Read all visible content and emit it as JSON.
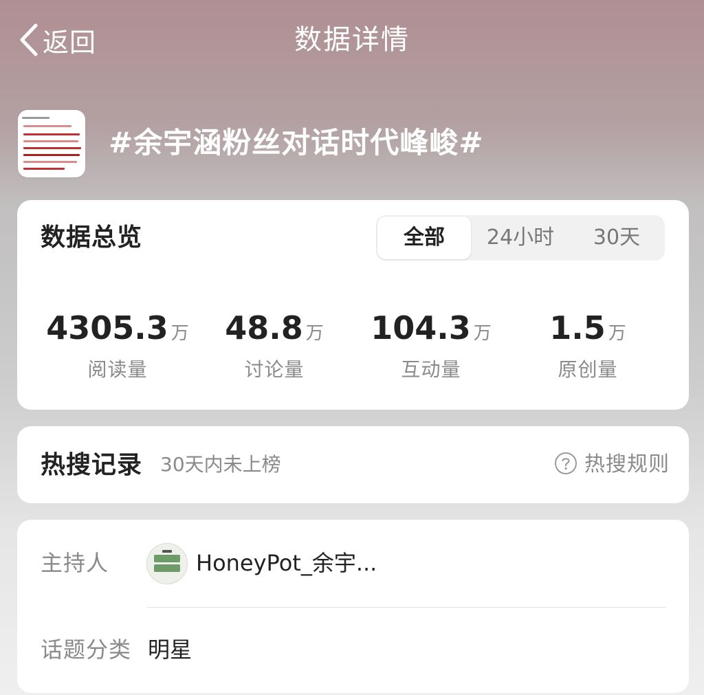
{
  "header": {
    "back_label": "返回",
    "title": "数据详情"
  },
  "topic": {
    "title": "#余宇涵粉丝对话时代峰峻#",
    "thumbnail": "document-thumbnail"
  },
  "overview": {
    "heading": "数据总览",
    "tabs": [
      {
        "label": "全部",
        "active": true
      },
      {
        "label": "24小时",
        "active": false
      },
      {
        "label": "30天",
        "active": false
      }
    ],
    "stats": [
      {
        "value": "4305.3",
        "unit": "万",
        "label": "阅读量"
      },
      {
        "value": "48.8",
        "unit": "万",
        "label": "讨论量"
      },
      {
        "value": "104.3",
        "unit": "万",
        "label": "互动量"
      },
      {
        "value": "1.5",
        "unit": "万",
        "label": "原创量"
      }
    ]
  },
  "hot_search": {
    "heading": "热搜记录",
    "status": "30天内未上榜",
    "rule_label": "热搜规则",
    "rule_icon": "question-circle-icon"
  },
  "info": {
    "host_label": "主持人",
    "host_name": "HoneyPot_余宇...",
    "host_avatar": "avatar",
    "category_label": "话题分类",
    "category_value": "明星"
  },
  "colors": {
    "header_bg_top": "#b08f93",
    "card_bg": "#ffffff",
    "text_primary": "#222222",
    "text_secondary": "#8a8a8a",
    "segment_bg": "#f1f1f1"
  }
}
